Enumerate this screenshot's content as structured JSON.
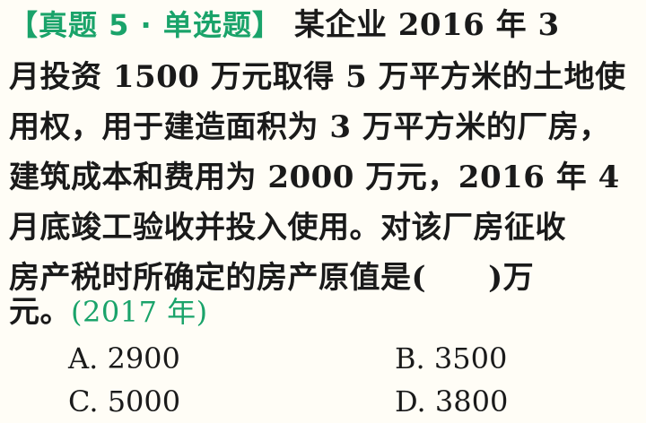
{
  "question": {
    "tag": "【真题 5 · 单选题】",
    "lines": [
      "某企业 2016 年 3",
      "月投资 1500 万元取得 5 万平方米的土地使",
      "用权，用于建造面积为 3 万平方米的厂房，",
      "建筑成本和费用为 2000 万元，2016 年 4",
      "月底竣工验收并投入使用。对该厂房征收",
      "房产税时所确定的房产原值是(　　)万",
      "元。"
    ],
    "year": "(2017 年)"
  },
  "options": [
    {
      "label": "A. 2900"
    },
    {
      "label": "B. 3500"
    },
    {
      "label": "C. 5000"
    },
    {
      "label": "D. 3800"
    }
  ]
}
